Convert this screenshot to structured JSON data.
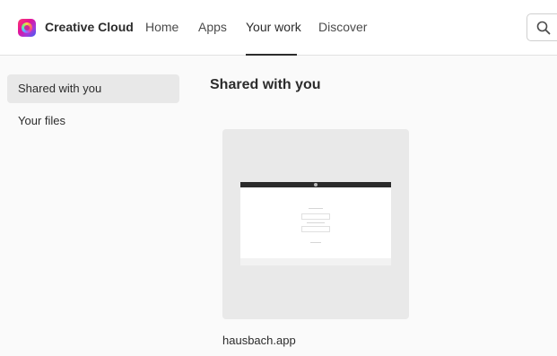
{
  "header": {
    "brand": "Creative Cloud",
    "nav": [
      {
        "label": "Home"
      },
      {
        "label": "Apps"
      },
      {
        "label": "Your work",
        "active": true
      },
      {
        "label": "Discover"
      }
    ],
    "search_icon": "search-icon",
    "logo_icon": "creative-cloud-logo"
  },
  "sidebar": {
    "items": [
      {
        "label": "Shared with you",
        "selected": true
      },
      {
        "label": "Your files"
      }
    ]
  },
  "main": {
    "title": "Shared with you",
    "files": [
      {
        "name": "hausbach.app"
      }
    ]
  },
  "colors": {
    "accent_text": "#2c2c2c",
    "selected_bg": "#e8e8e8",
    "card_bg": "#e9e9e9"
  }
}
